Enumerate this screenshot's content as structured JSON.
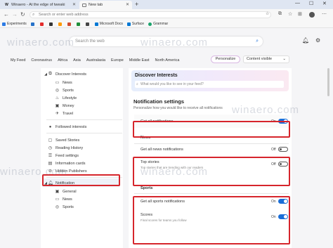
{
  "tabs": [
    {
      "icon": "W",
      "title": "Winaero - At the edge of tweaki"
    },
    {
      "icon": "",
      "title": "New tab"
    }
  ],
  "address_bar": {
    "placeholder": "Search or enter web address"
  },
  "favorites": [
    "Experiments",
    "",
    "",
    "",
    "",
    "",
    "",
    "",
    "Microsoft Docs",
    "Surface",
    "Grammar"
  ],
  "page": {
    "search_placeholder": "Search the web",
    "categories": [
      "My Feed",
      "Coronavirus",
      "Africa",
      "Asia",
      "Australasia",
      "Europe",
      "Middle East",
      "North America"
    ],
    "personalize": "Personalize",
    "content_visible": "Content visible"
  },
  "left_nav": {
    "discover_interests": "Discover Interests",
    "sub_interests": [
      "News",
      "Sports",
      "Lifestyle",
      "Money",
      "Travel"
    ],
    "followed_interests": "Followed interests",
    "saved_stories": "Saved Stories",
    "reading_history": "Reading History",
    "feed_settings": "Feed settings",
    "information_cards": "Information cards",
    "hidden_publishers": "Hidden Publishers",
    "notification": "Notification",
    "notification_sub": [
      "General",
      "News",
      "Sports"
    ]
  },
  "discover_panel": {
    "title": "Discover Interests",
    "input_placeholder": "What would you like to see in your feed?"
  },
  "notification_settings": {
    "title": "Notification settings",
    "subtitle": "Personalize how you would like to receive all notifications",
    "all": {
      "label": "Get all notifications",
      "state": "On"
    },
    "news_header": "News",
    "news_all": {
      "label": "Get all news notifications",
      "state": "Off"
    },
    "top_stories": {
      "label": "Top stories",
      "sub": "Top stories that are trending with our readers",
      "state": "Off"
    },
    "sports_header": "Sports",
    "sports_all": {
      "label": "Get all sports notifications",
      "state": "On"
    },
    "scores": {
      "label": "Scores",
      "sub": "Final scores for teams you follow",
      "state": "On"
    }
  },
  "watermark": "winaero.com",
  "colors": {
    "accent": "#1a6ed8",
    "highlight_box": "#d6252c"
  }
}
